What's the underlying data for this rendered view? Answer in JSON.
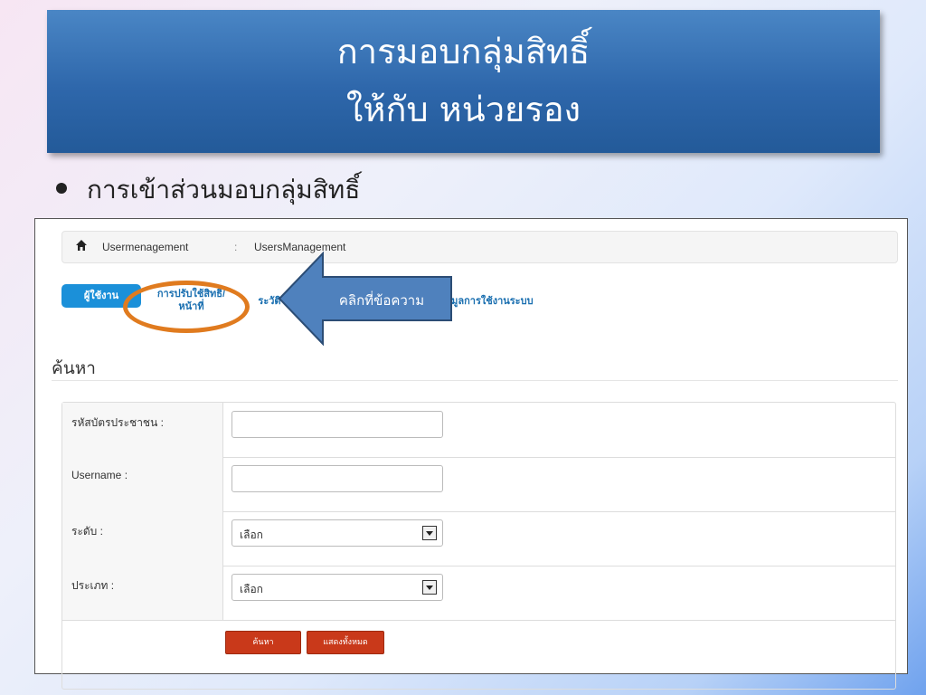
{
  "slide": {
    "title_line1": "การมอบกลุ่มสิทธิ์",
    "title_line2": "ให้กับ หน่วยรอง",
    "bullet": "การเข้าส่วนมอบกลุ่มสิทธิ์"
  },
  "breadcrumb": {
    "icon": "home-icon",
    "part1": "Usermenagement",
    "separator": ":",
    "part2": "UsersManagement"
  },
  "tabs": {
    "users": "ผู้ใช้งาน",
    "adjust_rights": "การปรับใช้สิทธิ์/ หน้าที่",
    "history_partial": "ระวัติ",
    "usage_info_partial": "ข้อมูลการใช้งานระบบ"
  },
  "annotation": {
    "callout_text": "คลิกที่ข้อความ",
    "ellipse_color": "#e07b1f",
    "arrow_color": "#4f81bd"
  },
  "search": {
    "heading": "ค้นหา",
    "id_card_label": "รหัสบัตรประชาชน :",
    "username_label": "Username :",
    "level_label": "ระดับ :",
    "level_value": "เลือก",
    "type_label": "ประเภท :",
    "type_value": "เลือก",
    "search_button": "ค้นหา",
    "show_all_button": "แสดงทั้งหมด"
  },
  "colors": {
    "title_bg": "#2e67ab",
    "tab_active": "#1b90d9",
    "button": "#c9391a"
  }
}
